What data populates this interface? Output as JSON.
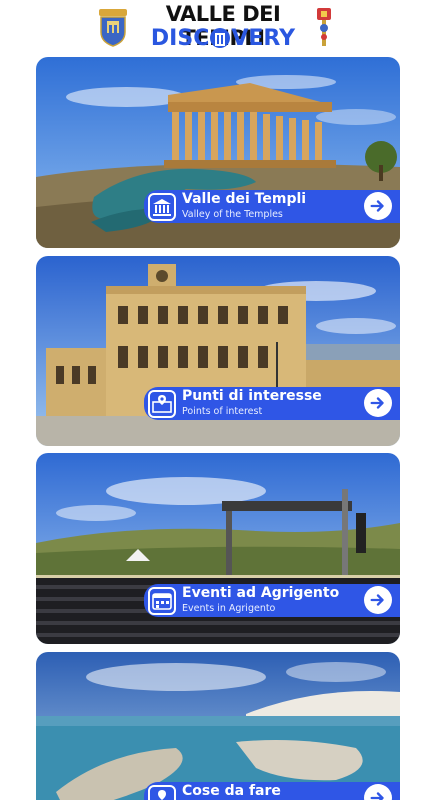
{
  "header": {
    "title_line1": "VALLE DEI TEMPLI",
    "title_part_a": "DISC",
    "title_part_b": "VERY",
    "crest_left_icon": "comune-agrigento-crest-icon",
    "crest_right_icon": "agrigento-emblem-icon",
    "accent_color": "#2a57e0"
  },
  "cards": [
    {
      "title": "Valle dei Templi",
      "subtitle": "Valley of the Temples",
      "icon": "temple-icon",
      "arrow_icon": "arrow-right-icon"
    },
    {
      "title": "Punti di interesse",
      "subtitle": "Points of interest",
      "icon": "map-pin-icon",
      "arrow_icon": "arrow-right-icon"
    },
    {
      "title": "Eventi ad Agrigento",
      "subtitle": "Events in Agrigento",
      "icon": "calendar-icon",
      "arrow_icon": "arrow-right-icon"
    },
    {
      "title": "Cose da fare",
      "subtitle": "",
      "icon": "places-icon",
      "arrow_icon": "arrow-right-icon"
    }
  ],
  "colors": {
    "banner": "#2f56e6",
    "sky": "#3f7fd9"
  }
}
